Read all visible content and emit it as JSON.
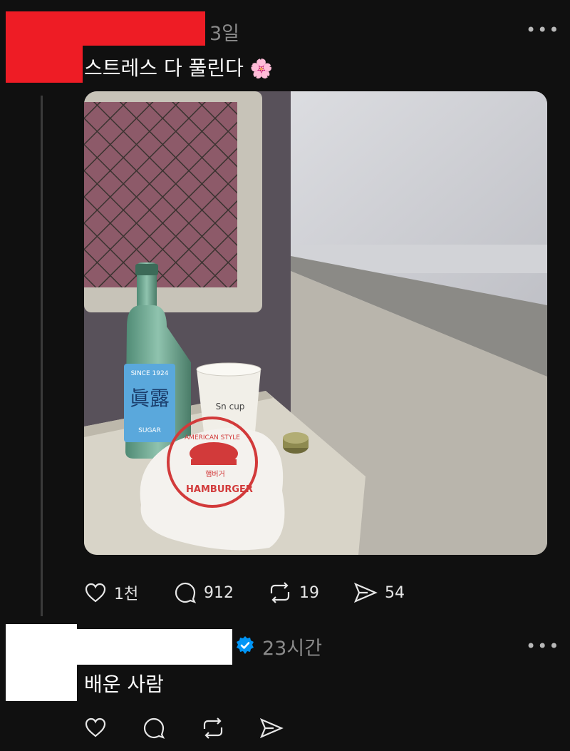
{
  "post1": {
    "time": "3일",
    "text": "스트레스 다 풀린다",
    "emoji": "🌸",
    "more_icon": "more-icon",
    "image": {
      "cup_text": "Sn cup",
      "bottle_brand": "眞露",
      "bottle_since": "SINCE 1924",
      "bottle_sub": "SUGAR",
      "wrapper_top": "AMERICAN STYLE",
      "wrapper_mid": "햄버거",
      "wrapper_bottom": "HAMBURGER"
    },
    "stats": {
      "likes": "1천",
      "comments": "912",
      "reposts": "19",
      "shares": "54"
    }
  },
  "post2": {
    "time": "23시간",
    "text": "배운 사람",
    "verified_icon": "verified-badge-icon"
  },
  "colors": {
    "background": "#101010",
    "redaction_red": "#ee1c25",
    "verified_blue": "#0095f6",
    "muted": "#8a8a8a"
  }
}
